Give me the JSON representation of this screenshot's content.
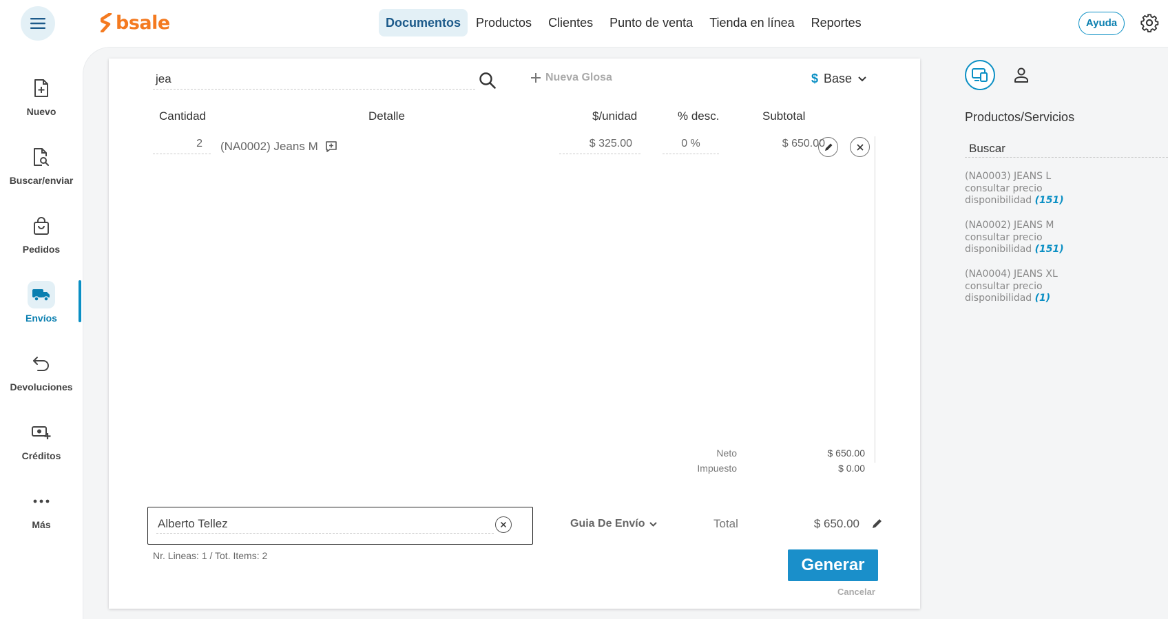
{
  "brand": {
    "name": "bsale",
    "color": "#f47a20"
  },
  "colors": {
    "accent": "#0a8fc4",
    "active_bg": "#e3f0f6",
    "primary_button": "#1a8fca"
  },
  "topnav": {
    "items": [
      {
        "label": "Documentos",
        "active": true
      },
      {
        "label": "Productos"
      },
      {
        "label": "Clientes"
      },
      {
        "label": "Punto de venta"
      },
      {
        "label": "Tienda en línea"
      },
      {
        "label": "Reportes"
      }
    ],
    "help_label": "Ayuda"
  },
  "sidebar": {
    "items": [
      {
        "label": "Nuevo",
        "icon": "file-plus-icon"
      },
      {
        "label": "Buscar/enviar",
        "icon": "file-search-icon"
      },
      {
        "label": "Pedidos",
        "icon": "shopping-bag-icon"
      },
      {
        "label": "Envíos",
        "icon": "truck-icon",
        "active": true
      },
      {
        "label": "Devoluciones",
        "icon": "return-arrow-icon"
      },
      {
        "label": "Créditos",
        "icon": "money-plus-icon"
      },
      {
        "label": "Más",
        "icon": "more-dots-icon"
      }
    ]
  },
  "editor": {
    "search_value": "jea",
    "new_gloss_label": "Nueva Glosa",
    "price_list_symbol": "$",
    "price_list_label": "Base",
    "columns": {
      "qty": "Cantidad",
      "detail": "Detalle",
      "unit_price": "$/unidad",
      "discount": "% desc.",
      "subtotal": "Subtotal"
    },
    "lines": [
      {
        "qty": "2",
        "detail": "(NA0002) Jeans M",
        "unit_price": "$ 325.00",
        "discount": "0 %",
        "subtotal": "$ 650.00"
      }
    ],
    "totals": {
      "net_label": "Neto",
      "net_value": "$ 650.00",
      "tax_label": "Impuesto",
      "tax_value": "$ 0.00",
      "total_label": "Total",
      "total_value": "$ 650.00"
    },
    "client_value": "Alberto Tellez",
    "document_type": "Guia De Envío",
    "summary": "Nr. Lineas: 1 / Tot. Items: 2",
    "generate_label": "Generar",
    "cancel_label": "Cancelar"
  },
  "right_panel": {
    "title": "Productos/Servicios",
    "search_placeholder": "Buscar",
    "products": [
      {
        "name": "(NA0003) JEANS L",
        "price": "consultar precio",
        "availability_label": "disponibilidad",
        "availability": "(151)"
      },
      {
        "name": "(NA0002) JEANS M",
        "price": "consultar precio",
        "availability_label": "disponibilidad",
        "availability": "(151)"
      },
      {
        "name": "(NA0004) JEANS XL",
        "price": "consultar precio",
        "availability_label": "disponibilidad",
        "availability": "(1)"
      }
    ]
  }
}
